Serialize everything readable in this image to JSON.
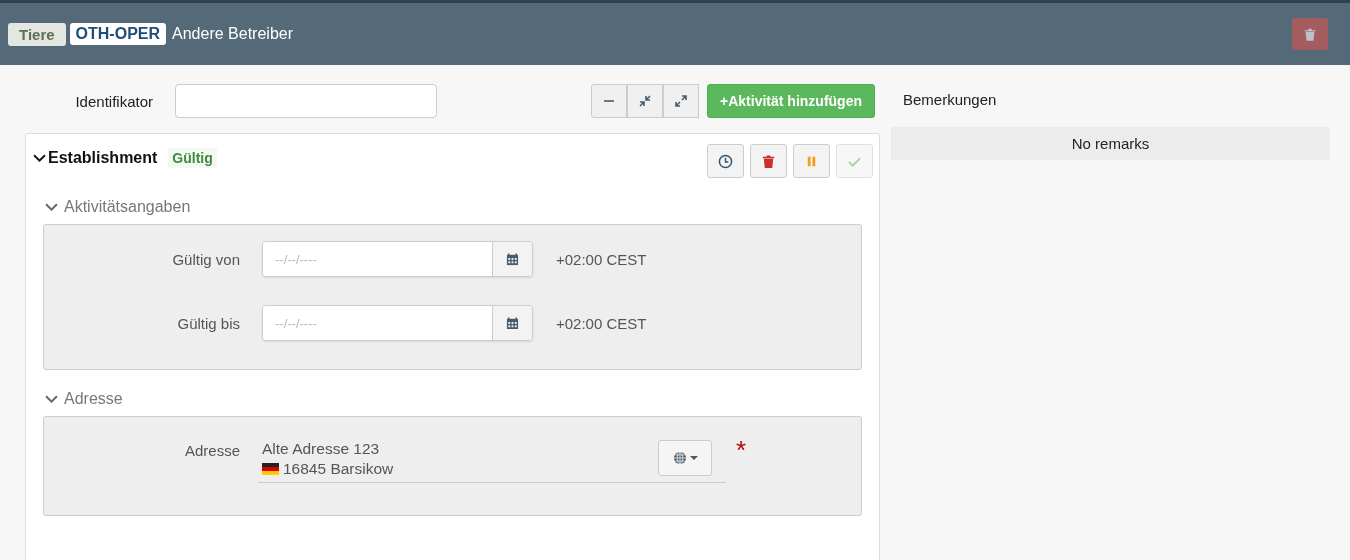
{
  "header": {
    "category": "Tiere",
    "code": "OTH-OPER",
    "title": "Andere Betreiber",
    "delete_disabled": true
  },
  "identifier": {
    "label": "Identifikator"
  },
  "toolbar": {
    "tools": [
      {
        "kind": "minus"
      },
      {
        "kind": "collapse"
      },
      {
        "kind": "expand"
      }
    ],
    "add_button": "+Aktivität hinzufügen"
  },
  "card": {
    "title": "Establishment",
    "expanded": true,
    "status": "Gültig",
    "actions": [
      {
        "kind": "history",
        "disabled": false
      },
      {
        "kind": "delete",
        "disabled": false
      },
      {
        "kind": "pause",
        "disabled": false
      },
      {
        "kind": "check",
        "disabled": true
      }
    ],
    "sections": [
      {
        "kind": "dates",
        "title": "Aktivitätsangaben",
        "expanded": true,
        "fields": [
          {
            "label": "Gültig von",
            "placeholder": "--/--/----",
            "timezone": "+02:00 CEST"
          },
          {
            "label": "Gültig bis",
            "placeholder": "--/--/----",
            "timezone": "+02:00 CEST"
          }
        ]
      },
      {
        "kind": "address",
        "title": "Adresse",
        "expanded": true,
        "label": "Adresse",
        "street": "Alte Adresse 123",
        "city": "16845 Barsikow",
        "required_mark": "*"
      }
    ]
  },
  "remarks": {
    "title": "Bemerkungen",
    "empty_text": "No remarks"
  }
}
